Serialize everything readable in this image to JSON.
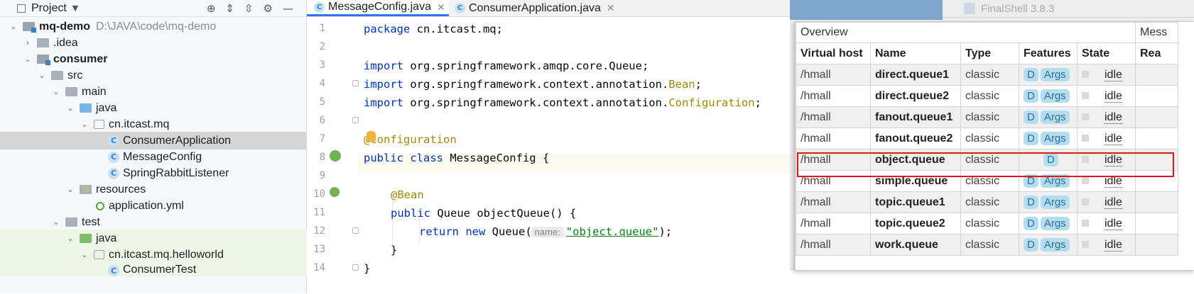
{
  "project": {
    "title": "Project",
    "tree": [
      {
        "label": "mq-demo",
        "path": "D:\\JAVA\\code\\mq-demo"
      },
      {
        "label": ".idea"
      },
      {
        "label": "consumer"
      },
      {
        "label": "src"
      },
      {
        "label": "main"
      },
      {
        "label": "java"
      },
      {
        "label": "cn.itcast.mq"
      },
      {
        "label": "ConsumerApplication"
      },
      {
        "label": "MessageConfig"
      },
      {
        "label": "SpringRabbitListener"
      },
      {
        "label": "resources"
      },
      {
        "label": "application.yml"
      },
      {
        "label": "test"
      },
      {
        "label": "java"
      },
      {
        "label": "cn.itcast.mq.helloworld"
      },
      {
        "label": "ConsumerTest"
      }
    ]
  },
  "editor": {
    "tabs": [
      {
        "label": "MessageConfig.java",
        "active": true
      },
      {
        "label": "ConsumerApplication.java",
        "active": false
      }
    ],
    "line_numbers": [
      "1",
      "2",
      "3",
      "4",
      "5",
      "6",
      "7",
      "8",
      "9",
      "10",
      "11",
      "12",
      "13",
      "14"
    ],
    "code": {
      "l1_kw": "package",
      "l1_rest": " cn.itcast.mq;",
      "import_kw": "import",
      "l3_rest": " org.springframework.amqp.core.Queue;",
      "l4_rest": " org.springframework.context.annotation.",
      "l4_ann": "Bean",
      "l4_end": ";",
      "l5_rest": " org.springframework.context.annotation.",
      "l5_ann": "Configuration",
      "l5_end": ";",
      "l7_ann": "@Configuration",
      "l8_kw": "public class",
      "l8_rest": " MessageConfig {",
      "l10_ann": "@Bean",
      "l11_kw": "public",
      "l11_rest": " Queue objectQueue() {",
      "l12_kw": "return new",
      "l12_rest": " Queue(",
      "l12_hint": "name:",
      "l12_str": "\"object.queue\"",
      "l12_end": ");",
      "l13": "}",
      "l14": "}"
    }
  },
  "finalshell": {
    "title": "FinalShell 3.8.3"
  },
  "rabbitmq": {
    "group_overview": "Overview",
    "group_messages": "Mess",
    "columns": [
      "Virtual host",
      "Name",
      "Type",
      "Features",
      "State",
      "Rea"
    ],
    "rows": [
      {
        "vhost": "/hmall",
        "name": "direct.queue1",
        "type": "classic",
        "f1": "D",
        "f2": "Args",
        "state": "idle"
      },
      {
        "vhost": "/hmall",
        "name": "direct.queue2",
        "type": "classic",
        "f1": "D",
        "f2": "Args",
        "state": "idle"
      },
      {
        "vhost": "/hmall",
        "name": "fanout.queue1",
        "type": "classic",
        "f1": "D",
        "f2": "Args",
        "state": "idle"
      },
      {
        "vhost": "/hmall",
        "name": "fanout.queue2",
        "type": "classic",
        "f1": "D",
        "f2": "Args",
        "state": "idle"
      },
      {
        "vhost": "/hmall",
        "name": "object.queue",
        "type": "classic",
        "f1": "D",
        "f2": "",
        "state": "idle"
      },
      {
        "vhost": "/hmall",
        "name": "simple.queue",
        "type": "classic",
        "f1": "D",
        "f2": "Args",
        "state": "idle"
      },
      {
        "vhost": "/hmall",
        "name": "topic.queue1",
        "type": "classic",
        "f1": "D",
        "f2": "Args",
        "state": "idle"
      },
      {
        "vhost": "/hmall",
        "name": "topic.queue2",
        "type": "classic",
        "f1": "D",
        "f2": "Args",
        "state": "idle"
      },
      {
        "vhost": "/hmall",
        "name": "work.queue",
        "type": "classic",
        "f1": "D",
        "f2": "Args",
        "state": "idle"
      }
    ],
    "highlight_color": "#e0161b"
  },
  "icons": [
    "project-icon",
    "target-icon",
    "expand-all-icon",
    "collapse-all-icon",
    "settings-icon",
    "minimize-icon",
    "class-icon",
    "spring-bean-icon"
  ]
}
